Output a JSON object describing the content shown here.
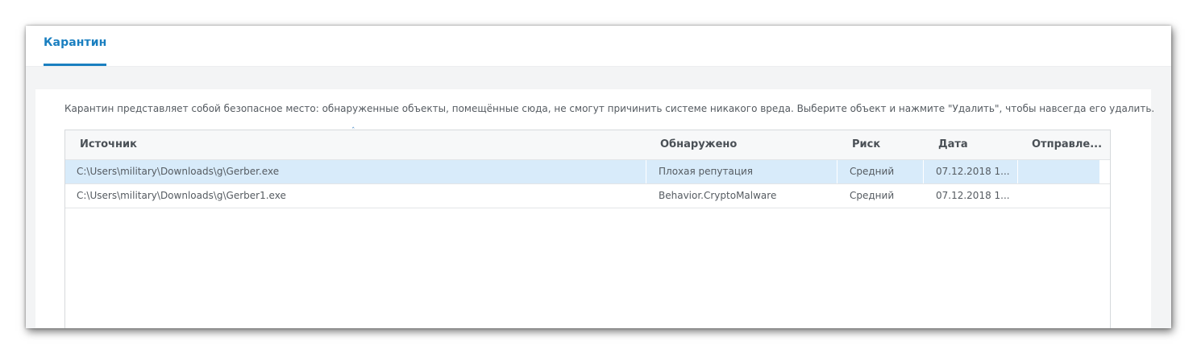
{
  "tabs": [
    {
      "label": "Карантин",
      "active": true
    }
  ],
  "description": "Карантин представляет собой безопасное место: обнаруженные объекты, помещённые сюда, не смогут причинить системе никакого вреда. Выберите объект и нажмите \"Удалить\", чтобы навсегда его удалить.",
  "table": {
    "sort_indicator": "ˆ",
    "columns": [
      "Источник",
      "Обнаружено",
      "Риск",
      "Дата",
      "Отправле..."
    ],
    "rows": [
      {
        "source": "C:\\Users\\military\\Downloads\\g\\Gerber.exe",
        "detected": "Плохая репутация",
        "risk": "Средний",
        "date": "07.12.2018 1...",
        "sent": "",
        "selected": true
      },
      {
        "source": "C:\\Users\\military\\Downloads\\g\\Gerber1.exe",
        "detected": "Behavior.CryptoMalware",
        "risk": "Средний",
        "date": "07.12.2018 1...",
        "sent": "",
        "selected": false
      }
    ]
  },
  "colors": {
    "accent": "#1a7fc0",
    "selected_row": "#d8ebfa"
  }
}
